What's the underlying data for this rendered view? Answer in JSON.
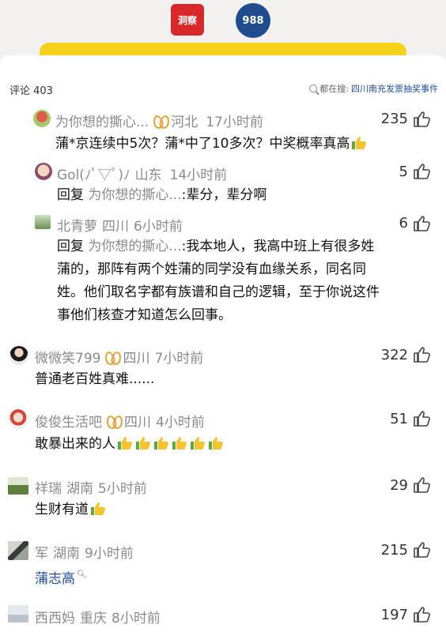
{
  "header": {
    "logo_left_text": "洞察",
    "logo_right_text": "988"
  },
  "panel": {
    "comment_count_label": "评论 403",
    "search_prefix": "都在搜:",
    "search_term": "四川南充发票抽奖事件"
  },
  "comments": [
    {
      "user": "为你想的撕心...",
      "has_badge": true,
      "location": "河北",
      "time": "17小时前",
      "likes": "235",
      "text": "蒲*京连续中5次？蒲*中了10多次？中奖概率真高",
      "thumbs": 1,
      "replies": [
        {
          "user": "Gol(ﾉﾟ▽ﾟ)ﾉ",
          "location": "山东",
          "time": "14小时前",
          "likes": "5",
          "reply_word": "回复",
          "reply_to": "为你想的撕心...",
          "text": ":辈分，辈分啊"
        },
        {
          "user": "北青萝",
          "location": "四川",
          "time": "6小时前",
          "likes": "6",
          "reply_word": "回复",
          "reply_to": "为你想的撕心...",
          "text_line1": ":我本地人，我高中班上有很多姓",
          "text_line2": "蒲的，那阵有两个姓蒲的同学没有血缘关系，同名同",
          "text_line3": "姓。他们取名字都有族谱和自己的逻辑，至于你说这件",
          "text_line4": "事他们核查才知道怎么回事。"
        }
      ]
    },
    {
      "user": "微微笑799",
      "has_badge": true,
      "location": "四川",
      "time": "7小时前",
      "likes": "322",
      "text": "普通老百姓真难......"
    },
    {
      "user": "俊俊生活吧",
      "has_badge": true,
      "location": "四川",
      "time": "4小时前",
      "likes": "51",
      "text": "敢暴出来的人",
      "thumbs": 6
    },
    {
      "user": "祥瑞",
      "location": "湖南",
      "time": "5小时前",
      "likes": "29",
      "text": "生财有道",
      "thumbs": 1
    },
    {
      "user": "军",
      "location": "湖南",
      "time": "9小时前",
      "likes": "215",
      "text": "蒲志高",
      "text_is_link": true
    },
    {
      "user": "西西妈",
      "location": "重庆",
      "time": "8小时前",
      "likes": "197"
    }
  ],
  "colors": {
    "meta_gray": "#8a8a8a",
    "link_blue": "#234fa0",
    "badge_gold": "#e3a13a",
    "thumb_yellow": "#f4c430"
  }
}
